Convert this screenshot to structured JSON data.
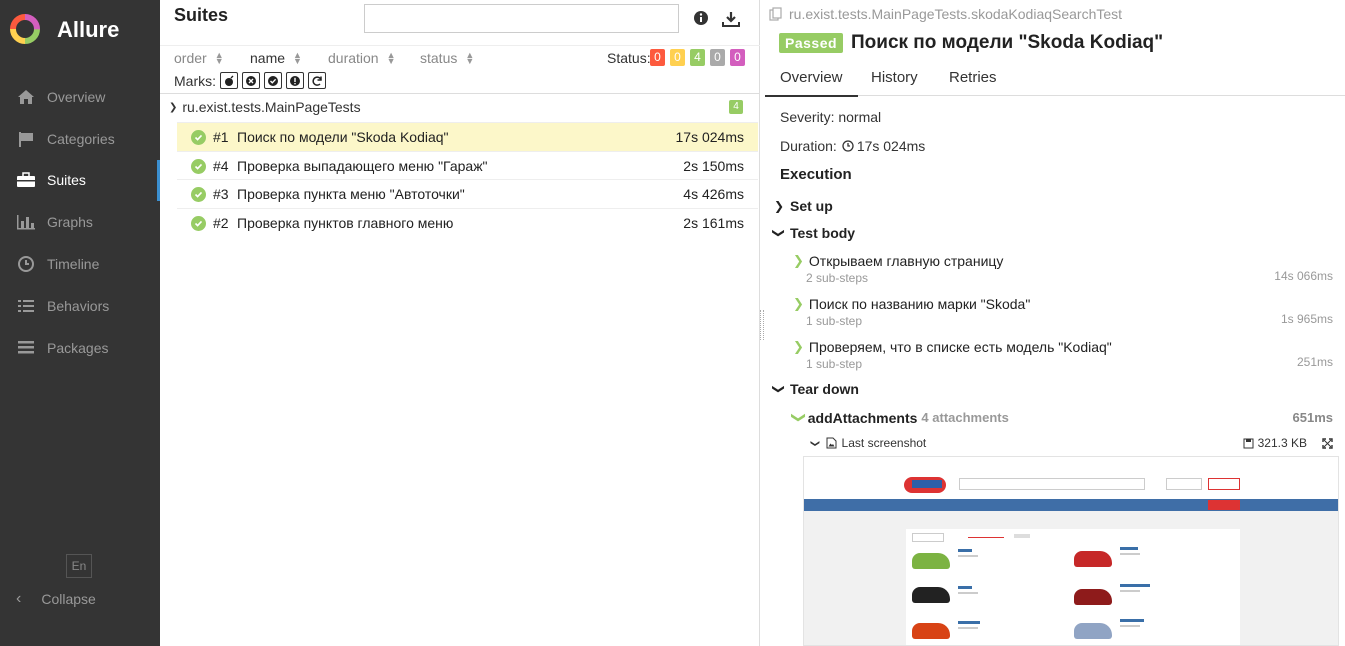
{
  "app": {
    "brand": "Allure",
    "language": "En",
    "collapse_label": "Collapse"
  },
  "sidebar": {
    "items": [
      {
        "label": "Overview",
        "icon": "home-icon"
      },
      {
        "label": "Categories",
        "icon": "flag-icon"
      },
      {
        "label": "Suites",
        "icon": "briefcase-icon",
        "active": true
      },
      {
        "label": "Graphs",
        "icon": "bar-chart-icon"
      },
      {
        "label": "Timeline",
        "icon": "clock-icon"
      },
      {
        "label": "Behaviors",
        "icon": "list-icon"
      },
      {
        "label": "Packages",
        "icon": "stack-icon"
      }
    ]
  },
  "suites": {
    "title": "Suites",
    "search_value": "",
    "sort": {
      "order": "order",
      "name": "name",
      "duration": "duration",
      "status": "status"
    },
    "status_label": "Status:",
    "status_counts": [
      {
        "value": "0",
        "color": "#fd5a3e"
      },
      {
        "value": "0",
        "color": "#ffd050"
      },
      {
        "value": "4",
        "color": "#97cc64"
      },
      {
        "value": "0",
        "color": "#aaaaaa"
      },
      {
        "value": "0",
        "color": "#d35ebe"
      }
    ],
    "marks_label": "Marks:",
    "group": {
      "name": "ru.exist.tests.MainPageTests",
      "count": "4"
    },
    "rows": [
      {
        "num": "#1",
        "name": "Поиск по модели \"Skoda Kodiaq\"",
        "duration": "17s 024ms",
        "selected": true
      },
      {
        "num": "#4",
        "name": "Проверка выпадающего меню \"Гараж\"",
        "duration": "2s 150ms"
      },
      {
        "num": "#3",
        "name": "Проверка пункта меню \"Автоточки\"",
        "duration": "4s 426ms"
      },
      {
        "num": "#2",
        "name": "Проверка пунктов главного меню",
        "duration": "2s 161ms"
      }
    ]
  },
  "test": {
    "full_name": "ru.exist.tests.MainPageTests.skodaKodiaqSearchTest",
    "status": "Passed",
    "title": "Поиск по модели \"Skoda Kodiaq\"",
    "tabs": [
      "Overview",
      "History",
      "Retries"
    ],
    "severity": "Severity: normal",
    "duration_label": "Duration:",
    "duration": "17s 024ms",
    "execution_label": "Execution",
    "setup_label": "Set up",
    "body_label": "Test body",
    "teardown_label": "Tear down",
    "steps": [
      {
        "name": "Открываем главную страницу",
        "sub": "2 sub-steps",
        "duration": "14s 066ms"
      },
      {
        "name": "Поиск по названию марки \"Skoda\"",
        "sub": "1 sub-step",
        "duration": "1s 965ms"
      },
      {
        "name": "Проверяем, что в списке есть модель \"Kodiaq\"",
        "sub": "1 sub-step",
        "duration": "251ms"
      }
    ],
    "attachments_step": {
      "name": "addAttachments",
      "count": "4 attachments",
      "duration": "651ms"
    },
    "screenshot": {
      "name": "Last screenshot",
      "size": "321.3 KB"
    }
  }
}
